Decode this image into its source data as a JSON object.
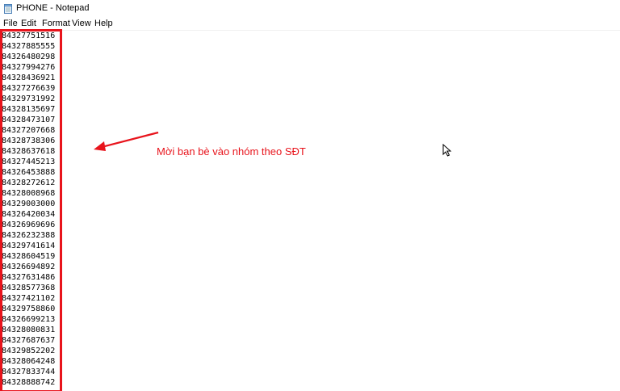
{
  "window": {
    "title": "PHONE - Notepad",
    "app_icon": "notepad-icon"
  },
  "menu": {
    "items": [
      "File",
      "Edit",
      "Format",
      "View",
      "Help"
    ]
  },
  "editor": {
    "lines": [
      "84327751516",
      "84327885555",
      "84326480298",
      "84327994276",
      "84328436921",
      "84327276639",
      "84329731992",
      "84328135697",
      "84328473107",
      "84327207668",
      "84328738306",
      "84328637618",
      "84327445213",
      "84326453888",
      "84328272612",
      "84328008968",
      "84329003000",
      "84326420034",
      "84326969696",
      "84326232388",
      "84329741614",
      "84328604519",
      "84326694892",
      "84327631486",
      "84328577368",
      "84327421102",
      "84329758860",
      "84326699213",
      "84328080831",
      "84327687637",
      "84329852202",
      "84328064248",
      "84327833744",
      "84328888742"
    ]
  },
  "annotation": {
    "text": "Mời bạn bè vào nhóm theo SĐT",
    "color": "#e8141c"
  },
  "icons": {
    "arrow": "left-arrow-icon",
    "cursor": "mouse-pointer-icon"
  }
}
